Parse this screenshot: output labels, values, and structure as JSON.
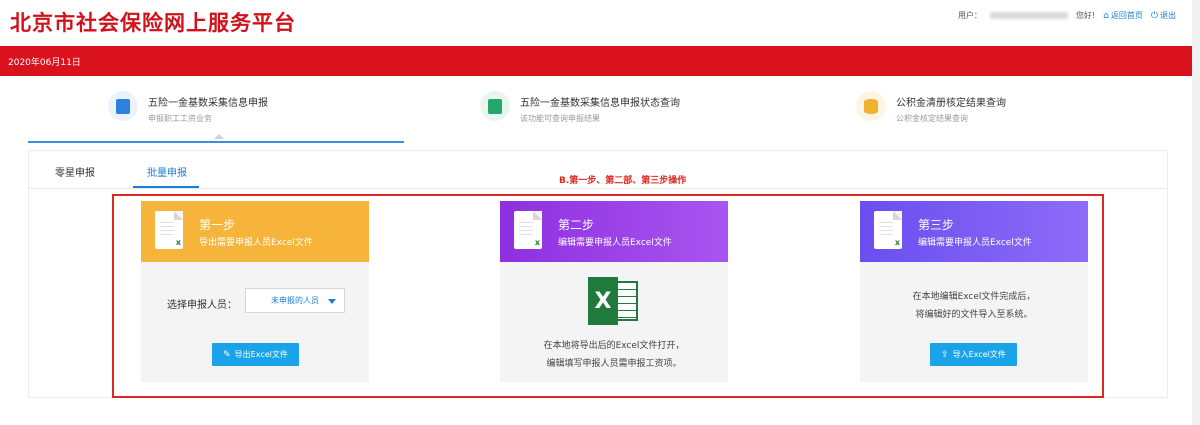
{
  "header": {
    "logo": "北京市社会保险网上服务平台",
    "user_label": "用户：",
    "greeting": "您好!",
    "home_label": "返回首页",
    "logout_label": "退出"
  },
  "date": "2020年06月11日",
  "nav": [
    {
      "title": "五险一金基数采集信息申报",
      "sub": "申报职工工资业务",
      "color": "#2f7fe0"
    },
    {
      "title": "五险一金基数采集信息申报状态查询",
      "sub": "该功能可查询申报结果",
      "color": "#23a86a"
    },
    {
      "title": "公积金清册核定结果查询",
      "sub": "公积金核定结果查询",
      "color": "#f1b32e"
    }
  ],
  "tabs": {
    "single": "零星申报",
    "batch": "批量申报"
  },
  "note": "B.第一步、第二部、第三步操作",
  "cards": [
    {
      "title": "第一步",
      "sub": "导出需要申报人员Excel文件",
      "select_label": "选择申报人员：",
      "select_value": "未申报的人员",
      "button": "导出Excel文件"
    },
    {
      "title": "第二步",
      "sub": "编辑需要申报人员Excel文件",
      "desc1": "在本地将导出后的Excel文件打开，",
      "desc2": "编辑填写申报人员需申报工资项。"
    },
    {
      "title": "第三步",
      "sub": "编辑需要申报人员Excel文件",
      "desc1": "在本地编辑Excel文件完成后，",
      "desc2": "将编辑好的文件导入至系统。",
      "button": "导入Excel文件"
    }
  ]
}
